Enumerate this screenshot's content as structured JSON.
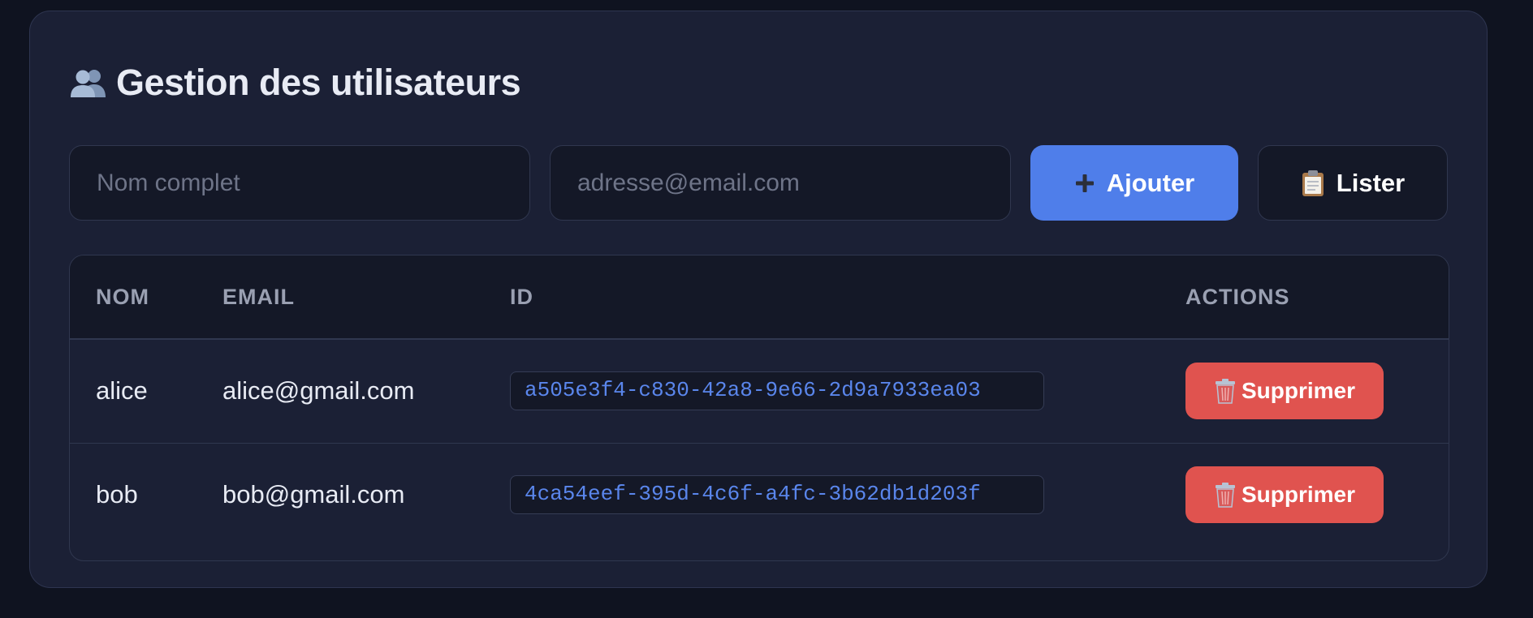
{
  "header": {
    "title": "Gestion des utilisateurs",
    "icon": "users-icon"
  },
  "form": {
    "name_placeholder": "Nom complet",
    "name_value": "",
    "email_placeholder": "adresse@email.com",
    "email_value": "",
    "add_label": "Ajouter",
    "add_icon": "plus-icon",
    "list_label": "Lister",
    "list_icon": "clipboard-icon"
  },
  "table": {
    "headers": [
      "Nom",
      "Email",
      "ID",
      "Actions"
    ],
    "rows": [
      {
        "name": "alice",
        "email": "alice@gmail.com",
        "id": "a505e3f4-c830-42a8-9e66-2d9a7933ea03",
        "action_label": "Supprimer",
        "action_icon": "trash-icon"
      },
      {
        "name": "bob",
        "email": "bob@gmail.com",
        "id": "4ca54eef-395d-4c6f-a4fc-3b62db1d203f",
        "action_label": "Supprimer",
        "action_icon": "trash-icon"
      }
    ]
  },
  "colors": {
    "background": "#0f1320",
    "card": "#1b2035",
    "accent": "#4f7eea",
    "danger": "#e0534f",
    "id_text": "#5a86ec"
  }
}
